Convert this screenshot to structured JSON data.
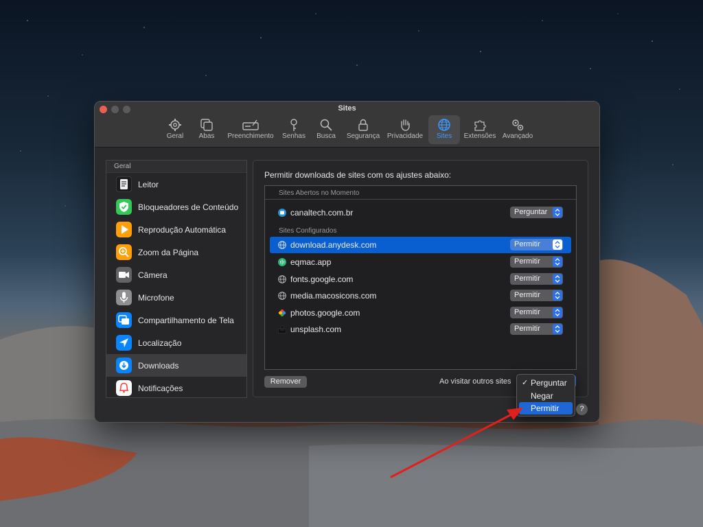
{
  "window": {
    "title": "Sites"
  },
  "tabs": [
    {
      "label": "Geral",
      "icon": "gear-icon"
    },
    {
      "label": "Abas",
      "icon": "tabs-icon"
    },
    {
      "label": "Preenchimento",
      "icon": "autofill-icon"
    },
    {
      "label": "Senhas",
      "icon": "key-icon"
    },
    {
      "label": "Busca",
      "icon": "magnifier-icon"
    },
    {
      "label": "Segurança",
      "icon": "lock-icon"
    },
    {
      "label": "Privacidade",
      "icon": "hand-icon"
    },
    {
      "label": "Sites",
      "icon": "globe-icon",
      "active": true
    },
    {
      "label": "Extensões",
      "icon": "puzzle-icon"
    },
    {
      "label": "Avançado",
      "icon": "gears-icon"
    }
  ],
  "sidebar": {
    "header": "Geral",
    "items": [
      {
        "label": "Leitor",
        "icon": "reader-icon",
        "color": "#1c1c1e"
      },
      {
        "label": "Bloqueadores de Conteúdo",
        "icon": "shield-check-icon",
        "color": "#34c759"
      },
      {
        "label": "Reprodução Automática",
        "icon": "play-icon",
        "color": "#ff9f0a"
      },
      {
        "label": "Zoom da Página",
        "icon": "zoom-icon",
        "color": "#ff9f0a"
      },
      {
        "label": "Câmera",
        "icon": "camera-icon",
        "color": "#636366"
      },
      {
        "label": "Microfone",
        "icon": "microphone-icon",
        "color": "#8e8e93"
      },
      {
        "label": "Compartilhamento de Tela",
        "icon": "screen-share-icon",
        "color": "#0a84ff"
      },
      {
        "label": "Localização",
        "icon": "location-icon",
        "color": "#0a84ff"
      },
      {
        "label": "Downloads",
        "icon": "download-icon",
        "color": "#0a84ff",
        "selected": true
      },
      {
        "label": "Notificações",
        "icon": "bell-icon",
        "color": "#ff3b30"
      }
    ]
  },
  "panel": {
    "heading": "Permitir downloads de sites com os ajustes abaixo:",
    "section_open": "Sites Abertos no Momento",
    "section_configured": "Sites Configurados",
    "open_sites": [
      {
        "name": "canaltech.com.br",
        "value": "Perguntar",
        "icon": "canaltech-icon"
      }
    ],
    "configured_sites": [
      {
        "name": "download.anydesk.com",
        "value": "Permitir",
        "icon": "globe-icon",
        "selected": true
      },
      {
        "name": "eqmac.app",
        "value": "Permitir",
        "icon": "eqmac-icon"
      },
      {
        "name": "fonts.google.com",
        "value": "Permitir",
        "icon": "globe-icon"
      },
      {
        "name": "media.macosicons.com",
        "value": "Permitir",
        "icon": "globe-icon"
      },
      {
        "name": "photos.google.com",
        "value": "Permitir",
        "icon": "google-photos-icon"
      },
      {
        "name": "unsplash.com",
        "value": "Permitir",
        "icon": "unsplash-icon"
      }
    ],
    "remove_label": "Remover",
    "visit_label": "Ao visitar outros sites"
  },
  "dropdown": {
    "checkmark": "✓",
    "options": [
      {
        "label": "Perguntar",
        "checked": true
      },
      {
        "label": "Negar"
      },
      {
        "label": "Permitir",
        "highlighted": true
      }
    ]
  },
  "help_label": "?"
}
